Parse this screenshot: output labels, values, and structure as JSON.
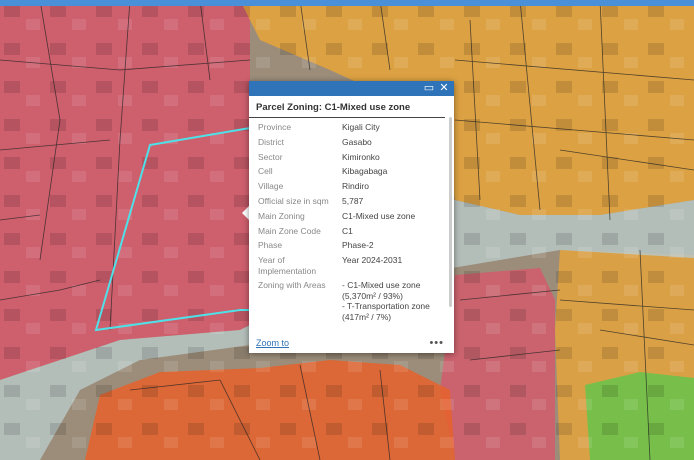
{
  "popup": {
    "title": "Parcel Zoning: C1-Mixed use zone",
    "rows": [
      {
        "key": "Province",
        "value": "Kigali City"
      },
      {
        "key": "District",
        "value": "Gasabo"
      },
      {
        "key": "Sector",
        "value": "Kimironko"
      },
      {
        "key": "Cell",
        "value": "Kibagabaga"
      },
      {
        "key": "Village",
        "value": "Rindiro"
      },
      {
        "key": "Official size in sqm",
        "value": "5,787"
      },
      {
        "key": "Main Zoning",
        "value": "C1-Mixed use zone"
      },
      {
        "key": "Main Zone Code",
        "value": "C1"
      },
      {
        "key": "Phase",
        "value": "Phase-2"
      },
      {
        "key": "Year of Implementation",
        "value": "Year 2024-2031"
      },
      {
        "key": "Zoning with Areas",
        "value": "- C1-Mixed use zone (5,370m² / 93%)\n- T-Transportation zone (417m² / 7%)"
      }
    ],
    "zoom_label": "Zoom to",
    "more_label": "•••",
    "maximize_icon": "maximize-icon",
    "close_icon": "close-icon"
  },
  "colors": {
    "mixed_use_zone": "#d9556a",
    "commercial_zone": "#e8a53a",
    "industrial_zone": "#e8622b",
    "green_zone": "#6cc24a",
    "transportation_zone": "#b9c7c4",
    "parcel_highlight": "#4fe0e8",
    "popup_header": "#2f73b8"
  }
}
